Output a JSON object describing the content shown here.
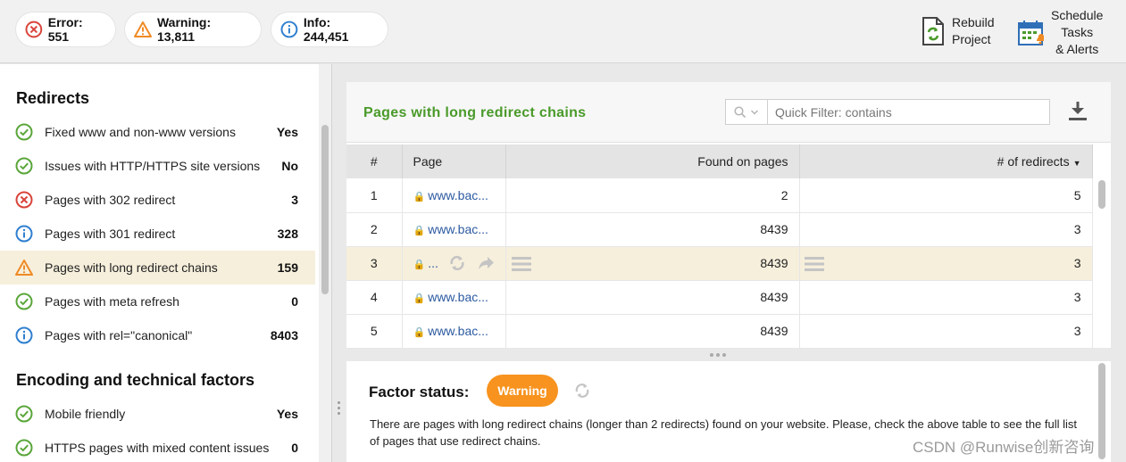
{
  "topbar": {
    "error": "Error: 551",
    "warning": "Warning: 13,811",
    "info": "Info: 244,451",
    "rebuild_line1": "Rebuild",
    "rebuild_line2": "Project",
    "schedule_line1": "Schedule",
    "schedule_line2": "Tasks",
    "schedule_line3": "& Alerts"
  },
  "sidebar": {
    "sections": [
      {
        "title": "Redirects",
        "items": [
          {
            "status": "ok",
            "label": "Fixed www and non-www versions",
            "value": "Yes"
          },
          {
            "status": "ok",
            "label": "Issues with HTTP/HTTPS site versions",
            "value": "No"
          },
          {
            "status": "error",
            "label": "Pages with 302 redirect",
            "value": "3"
          },
          {
            "status": "info",
            "label": "Pages with 301 redirect",
            "value": "328"
          },
          {
            "status": "warning",
            "label": "Pages with long redirect chains",
            "value": "159",
            "selected": true
          },
          {
            "status": "ok",
            "label": "Pages with meta refresh",
            "value": "0"
          },
          {
            "status": "info",
            "label": "Pages with rel=\"canonical\"",
            "value": "8403"
          }
        ]
      },
      {
        "title": "Encoding and technical factors",
        "items": [
          {
            "status": "ok",
            "label": "Mobile friendly",
            "value": "Yes"
          },
          {
            "status": "ok",
            "label": "HTTPS pages with mixed content issues",
            "value": "0"
          }
        ]
      }
    ]
  },
  "main": {
    "title": "Pages with long redirect chains",
    "filter_placeholder": "Quick Filter: contains",
    "columns": [
      "#",
      "Page",
      "Found on pages",
      "# of redirects"
    ],
    "rows": [
      {
        "num": "1",
        "page": "www.bac...",
        "found": "2",
        "redirects": "5"
      },
      {
        "num": "2",
        "page": "www.bac...",
        "found": "8439",
        "redirects": "3"
      },
      {
        "num": "3",
        "page": "...",
        "found": "8439",
        "redirects": "3",
        "highlighted": true
      },
      {
        "num": "4",
        "page": "www.bac...",
        "found": "8439",
        "redirects": "3"
      },
      {
        "num": "5",
        "page": "www.bac...",
        "found": "8439",
        "redirects": "3"
      }
    ]
  },
  "status": {
    "label": "Factor status:",
    "badge": "Warning",
    "text": "There are pages with long redirect chains (longer than 2 redirects) found on your website. Please, check the above table to see the full list of pages that use redirect chains."
  },
  "watermark": "CSDN @Runwise创新咨询",
  "colors": {
    "ok": "#5aa63a",
    "error": "#d9443a",
    "warning": "#f08a24",
    "info": "#2f7fd0",
    "title_green": "#4a9a2a",
    "badge": "#f7931e",
    "selected_row": "#f6efdc"
  }
}
